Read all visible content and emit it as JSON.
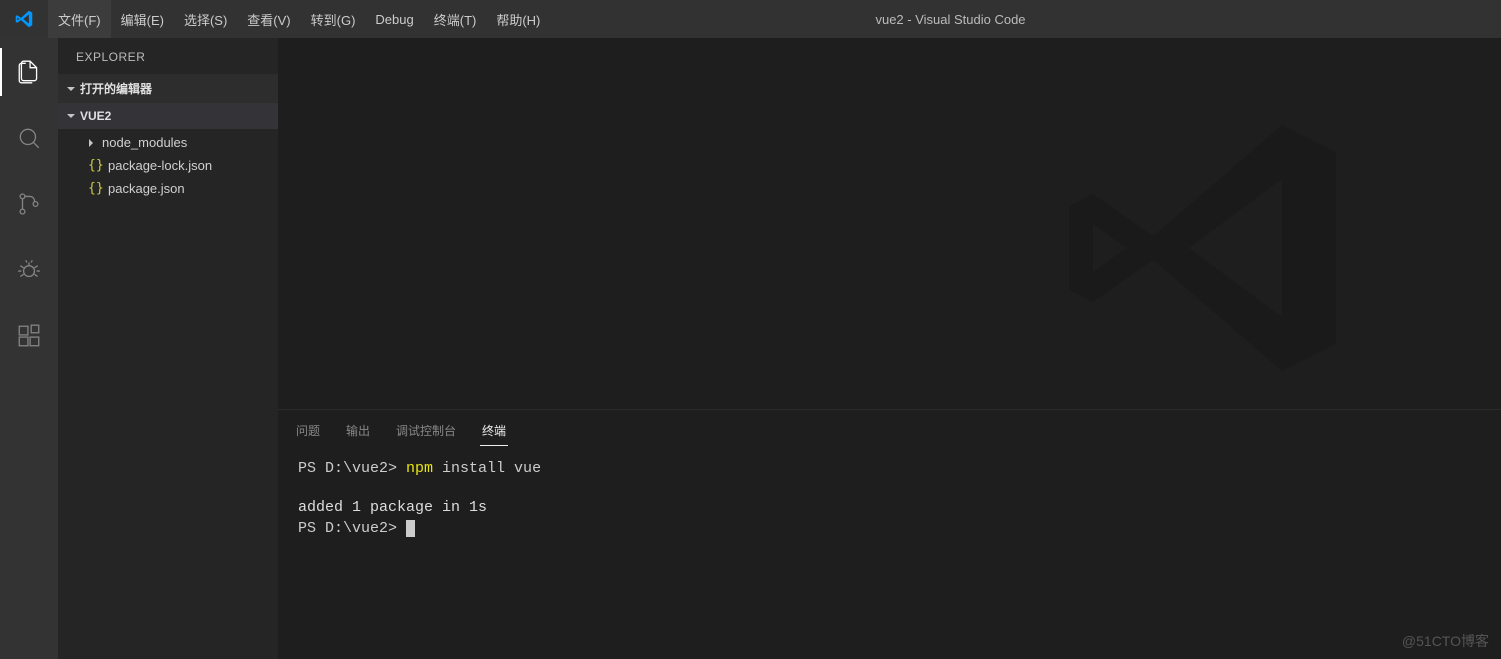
{
  "title": "vue2 - Visual Studio Code",
  "menu": {
    "file": "文件(F)",
    "edit": "编辑(E)",
    "select": "选择(S)",
    "view": "查看(V)",
    "go": "转到(G)",
    "debug": "Debug",
    "terminal": "终端(T)",
    "help": "帮助(H)"
  },
  "sidebar": {
    "title": "EXPLORER",
    "openEditors": "打开的编辑器",
    "projectName": "VUE2",
    "items": {
      "nodeModules": "node_modules",
      "packageLock": "package-lock.json",
      "packageJson": "package.json"
    }
  },
  "panel": {
    "tabs": {
      "problems": "问题",
      "output": "输出",
      "debugConsole": "调试控制台",
      "terminal": "终端"
    }
  },
  "terminal": {
    "prompt1": "PS D:\\vue2> ",
    "cmdNpm": "npm",
    "cmdRest": " install vue",
    "output": "added 1 package in 1s",
    "prompt2": "PS D:\\vue2> "
  },
  "watermark": "@51CTO博客"
}
